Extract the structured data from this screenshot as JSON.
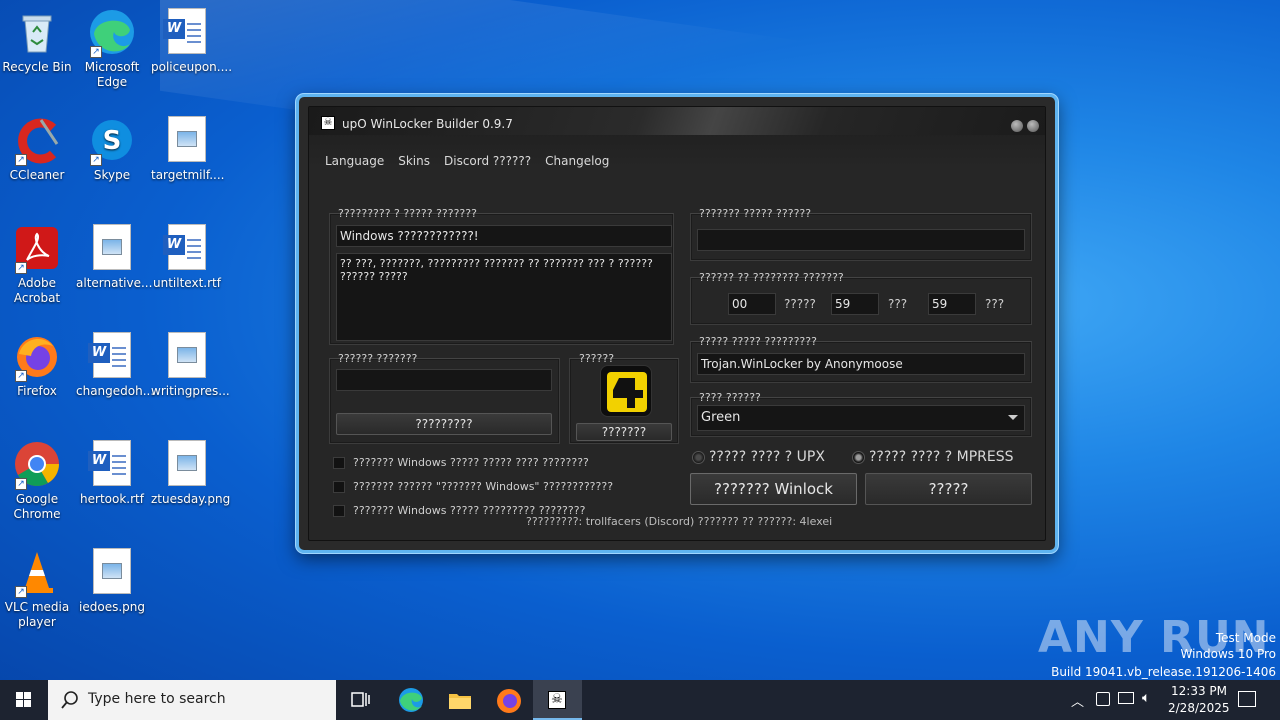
{
  "desktop": {
    "icons": [
      {
        "label": "Recycle Bin"
      },
      {
        "label": "Microsoft Edge"
      },
      {
        "label": "policeupon...."
      },
      {
        "label": "CCleaner"
      },
      {
        "label": "Skype"
      },
      {
        "label": "targetmilf...."
      },
      {
        "label": "Adobe Acrobat"
      },
      {
        "label": "alternative..."
      },
      {
        "label": "untiltext.rtf"
      },
      {
        "label": "Firefox"
      },
      {
        "label": "changedoh..."
      },
      {
        "label": "writingpres..."
      },
      {
        "label": "Google Chrome"
      },
      {
        "label": "hertook.rtf"
      },
      {
        "label": "ztuesday.png"
      },
      {
        "label": "VLC media player"
      },
      {
        "label": "iedoes.png"
      }
    ]
  },
  "window": {
    "title": "upO WinLocker Builder 0.9.7",
    "menu": [
      "Language",
      "Skins",
      "Discord ??????",
      "Changelog"
    ],
    "message_group": {
      "label": "????????? ? ????? ???????",
      "title_value": "Windows ????????????!",
      "body_value": "?? ???, ???????, ????????? ??????? ?? ??????? ??? ? ?????? ?????? ?????"
    },
    "password_group": {
      "label": "?????? ???????",
      "value": "",
      "button": "?????????"
    },
    "icon_group": {
      "label": "??????",
      "button": "???????"
    },
    "checkboxes": [
      {
        "label": "??????? Windows ????? ????? ???? ????????",
        "checked": false
      },
      {
        "label": "??????? ?????? \"??????? Windows\" ????????????",
        "checked": false
      },
      {
        "label": "??????? Windows ????? ????????? ????????",
        "checked": false
      }
    ],
    "unlock_group": {
      "label": "??????? ????? ??????",
      "value": ""
    },
    "timer_group": {
      "label": "?????? ?? ???????? ???????",
      "hours": "00",
      "hours_unit": "?????",
      "minutes": "59",
      "minutes_unit": "???",
      "seconds": "59",
      "seconds_unit": "???"
    },
    "name_group": {
      "label": "????? ????? ?????????",
      "value": "Trojan.WinLocker by Anonymoose"
    },
    "color_group": {
      "label": "???? ??????",
      "selected": "Green"
    },
    "radios": [
      {
        "label": "????? ???? ? UPX",
        "selected": false
      },
      {
        "label": "????? ???? ? MPRESS",
        "selected": true
      }
    ],
    "build_button": "??????? Winlock",
    "exit_button": "?????",
    "footer": "?????????: trollfacers (Discord) ??????? ?? ??????: 4lexei"
  },
  "taskbar": {
    "search_placeholder": "Type here to search",
    "time": "12:33 PM",
    "date": "2/28/2025"
  },
  "watermark": {
    "brand": "ANY RUN",
    "line1": "Test Mode",
    "line2": "Windows 10 Pro",
    "line3": "Build 19041.vb_release.191206-1406"
  },
  "colors": {
    "window_border": "#5fb4f0",
    "desktop": "#0a5fcf",
    "taskbar": "#1d2330",
    "chrome_bg": "#262626"
  }
}
